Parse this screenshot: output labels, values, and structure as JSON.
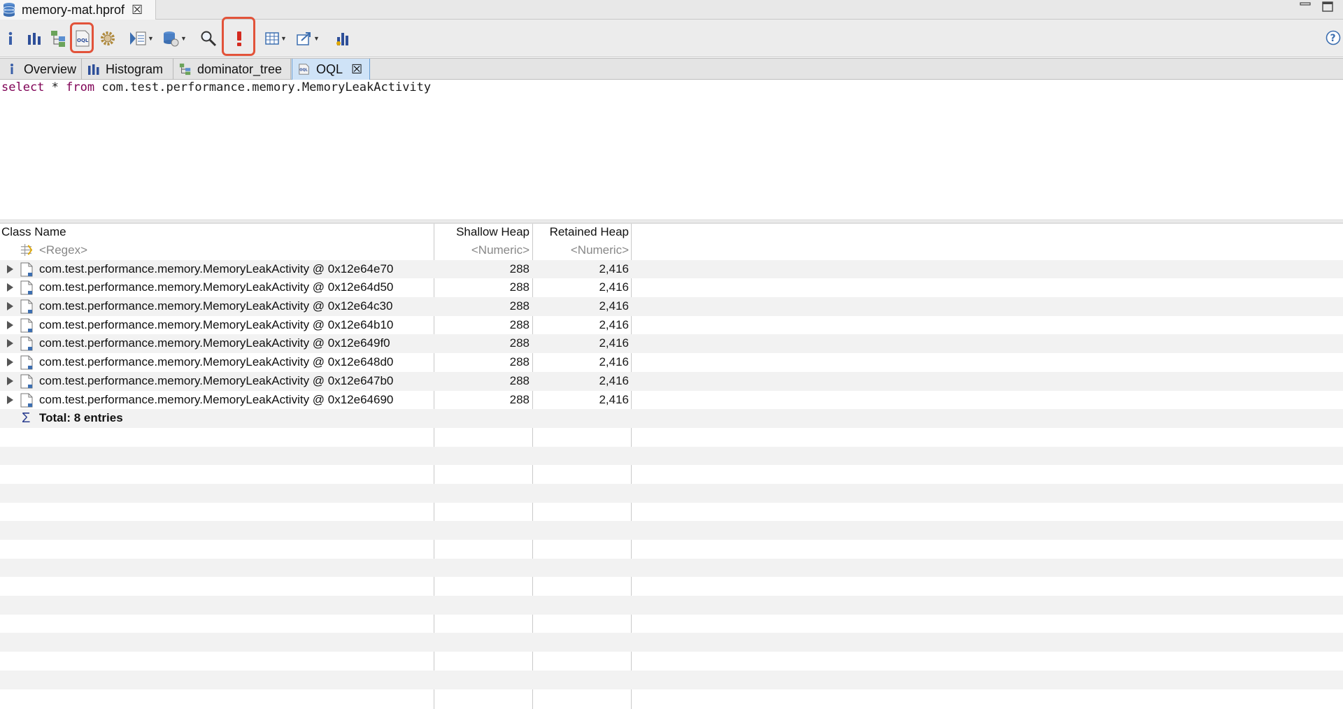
{
  "editor": {
    "file_tab": "memory-mat.hprof"
  },
  "toolbar": {
    "buttons": [
      {
        "name": "info-icon"
      },
      {
        "name": "histogram-icon"
      },
      {
        "name": "dominator-tree-icon"
      },
      {
        "name": "oql-icon",
        "highlighted": true
      },
      {
        "name": "gear-icon"
      },
      {
        "name": "run-report-icon"
      },
      {
        "name": "query-browser-icon"
      },
      {
        "name": "search-icon"
      },
      {
        "name": "execute-query-icon",
        "highlighted": true
      },
      {
        "name": "table-icon"
      },
      {
        "name": "export-icon"
      },
      {
        "name": "chart-icon"
      }
    ],
    "highlight_color": "#e2533a"
  },
  "view_tabs": [
    {
      "label": "Overview",
      "icon": "info-icon"
    },
    {
      "label": "Histogram",
      "icon": "histogram-icon"
    },
    {
      "label": "dominator_tree",
      "icon": "dominator-tree-icon"
    },
    {
      "label": "OQL",
      "icon": "oql-icon",
      "active": true
    }
  ],
  "query": {
    "kw_select": "select",
    "star": " * ",
    "kw_from": "from",
    "target": " com.test.performance.memory.MemoryLeakActivity"
  },
  "table": {
    "headers": {
      "class_name": "Class Name",
      "shallow_heap": "Shallow Heap",
      "retained_heap": "Retained Heap"
    },
    "filter_row": {
      "name": "<Regex>",
      "shallow": "<Numeric>",
      "retained": "<Numeric>"
    },
    "rows": [
      {
        "name": "com.test.performance.memory.MemoryLeakActivity @ 0x12e64e70",
        "shallow": "288",
        "retained": "2,416"
      },
      {
        "name": "com.test.performance.memory.MemoryLeakActivity @ 0x12e64d50",
        "shallow": "288",
        "retained": "2,416"
      },
      {
        "name": "com.test.performance.memory.MemoryLeakActivity @ 0x12e64c30",
        "shallow": "288",
        "retained": "2,416"
      },
      {
        "name": "com.test.performance.memory.MemoryLeakActivity @ 0x12e64b10",
        "shallow": "288",
        "retained": "2,416"
      },
      {
        "name": "com.test.performance.memory.MemoryLeakActivity @ 0x12e649f0",
        "shallow": "288",
        "retained": "2,416"
      },
      {
        "name": "com.test.performance.memory.MemoryLeakActivity @ 0x12e648d0",
        "shallow": "288",
        "retained": "2,416"
      },
      {
        "name": "com.test.performance.memory.MemoryLeakActivity @ 0x12e647b0",
        "shallow": "288",
        "retained": "2,416"
      },
      {
        "name": "com.test.performance.memory.MemoryLeakActivity @ 0x12e64690",
        "shallow": "288",
        "retained": "2,416"
      }
    ],
    "total": "Total: 8 entries"
  }
}
